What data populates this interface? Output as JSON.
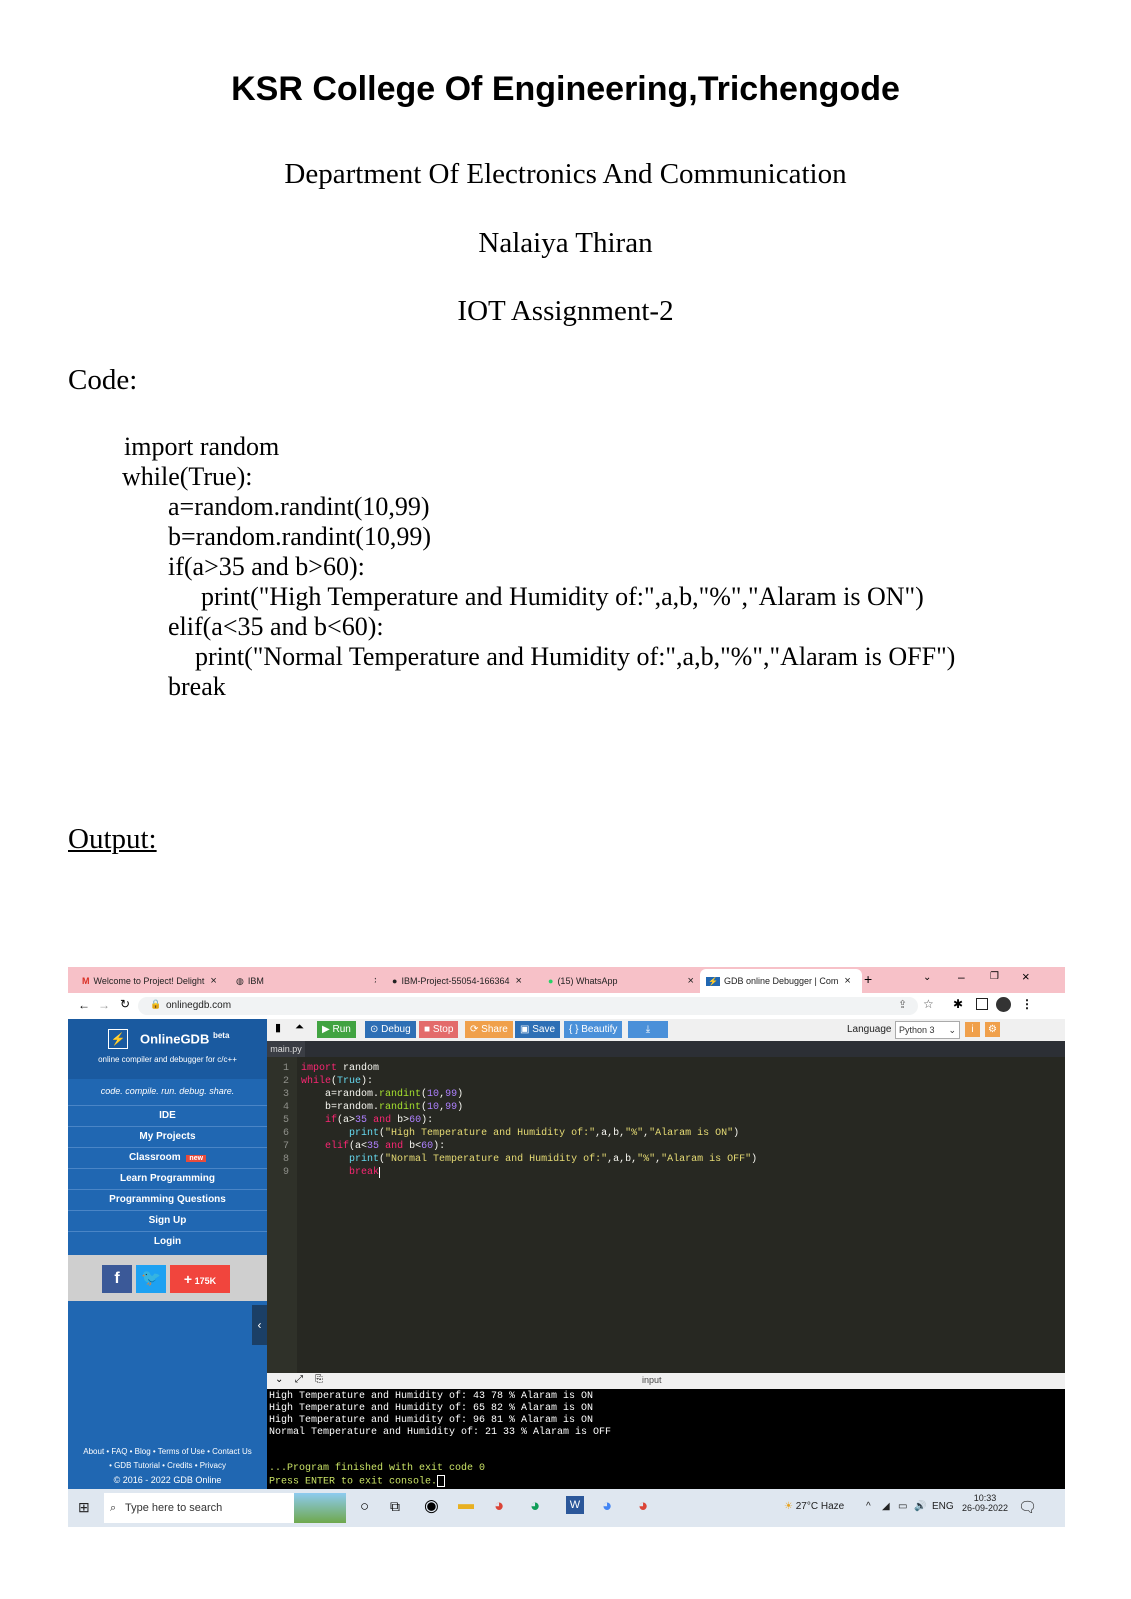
{
  "document": {
    "title": "KSR College Of Engineering,Trichengode",
    "department": "Department Of Electronics And Communication",
    "program": "Nalaiya Thiran",
    "assignment": "IOT Assignment-2",
    "code_heading": "Code:",
    "code_lines": [
      "import random",
      "while(True):",
      "a=random.randint(10,99)",
      "b=random.randint(10,99)",
      "if(a>35 and b>60):",
      "print(\"High Temperature and Humidity of:\",a,b,\"%\",\"Alaram is ON\")",
      "elif(a<35 and b<60):",
      "print(\"Normal Temperature and Humidity of:\",a,b,\"%\",\"Alaram is OFF\")",
      "break"
    ],
    "output_heading": "Output:"
  },
  "screenshot": {
    "browser_tabs": [
      {
        "label": "Welcome to Project! Delight"
      },
      {
        "label": "IBM"
      },
      {
        "label": "IBM-Project-55054-166364"
      },
      {
        "label": "(15) WhatsApp"
      },
      {
        "label": "GDB online Debugger | Com"
      }
    ],
    "new_tab_glyph": "+",
    "url": "onlinegdb.com",
    "sidebar": {
      "brand": "OnlineGDB",
      "brand_sup": "beta",
      "tagline": "online compiler and debugger for c/c++",
      "motto": "code. compile. run. debug. share.",
      "nav": [
        "IDE",
        "My Projects",
        "Classroom",
        "Learn Programming",
        "Programming Questions",
        "Sign Up",
        "Login"
      ],
      "classroom_badge": "new",
      "share_count": "175K",
      "footer_line1": "About • FAQ • Blog • Terms of Use • Contact Us",
      "footer_line2": "• GDB Tutorial • Credits • Privacy",
      "footer_line3": "© 2016 - 2022 GDB Online"
    },
    "toolbar": {
      "run": "Run",
      "debug": "Debug",
      "stop": "Stop",
      "share": "Share",
      "save": "Save",
      "beautify": "{ } Beautify",
      "language_label": "Language",
      "language_value": "Python 3"
    },
    "file_tab": "main.py",
    "editor_lines": [
      "1",
      "2",
      "3",
      "4",
      "5",
      "6",
      "7",
      "8",
      "9"
    ],
    "io_label": "input",
    "console_lines": [
      "High Temperature and Humidity of: 43 78 % Alaram is ON",
      "High Temperature and Humidity of: 65 82 % Alaram is ON",
      "High Temperature and Humidity of: 96 81 % Alaram is ON",
      "Normal Temperature and Humidity of: 21 33 % Alaram is OFF",
      "",
      "",
      "...Program finished with exit code 0",
      "Press ENTER to exit console."
    ],
    "taskbar": {
      "search_placeholder": "Type here to search",
      "weather": "27°C  Haze",
      "lang": "ENG",
      "time": "10:33",
      "date": "26-09-2022"
    }
  }
}
